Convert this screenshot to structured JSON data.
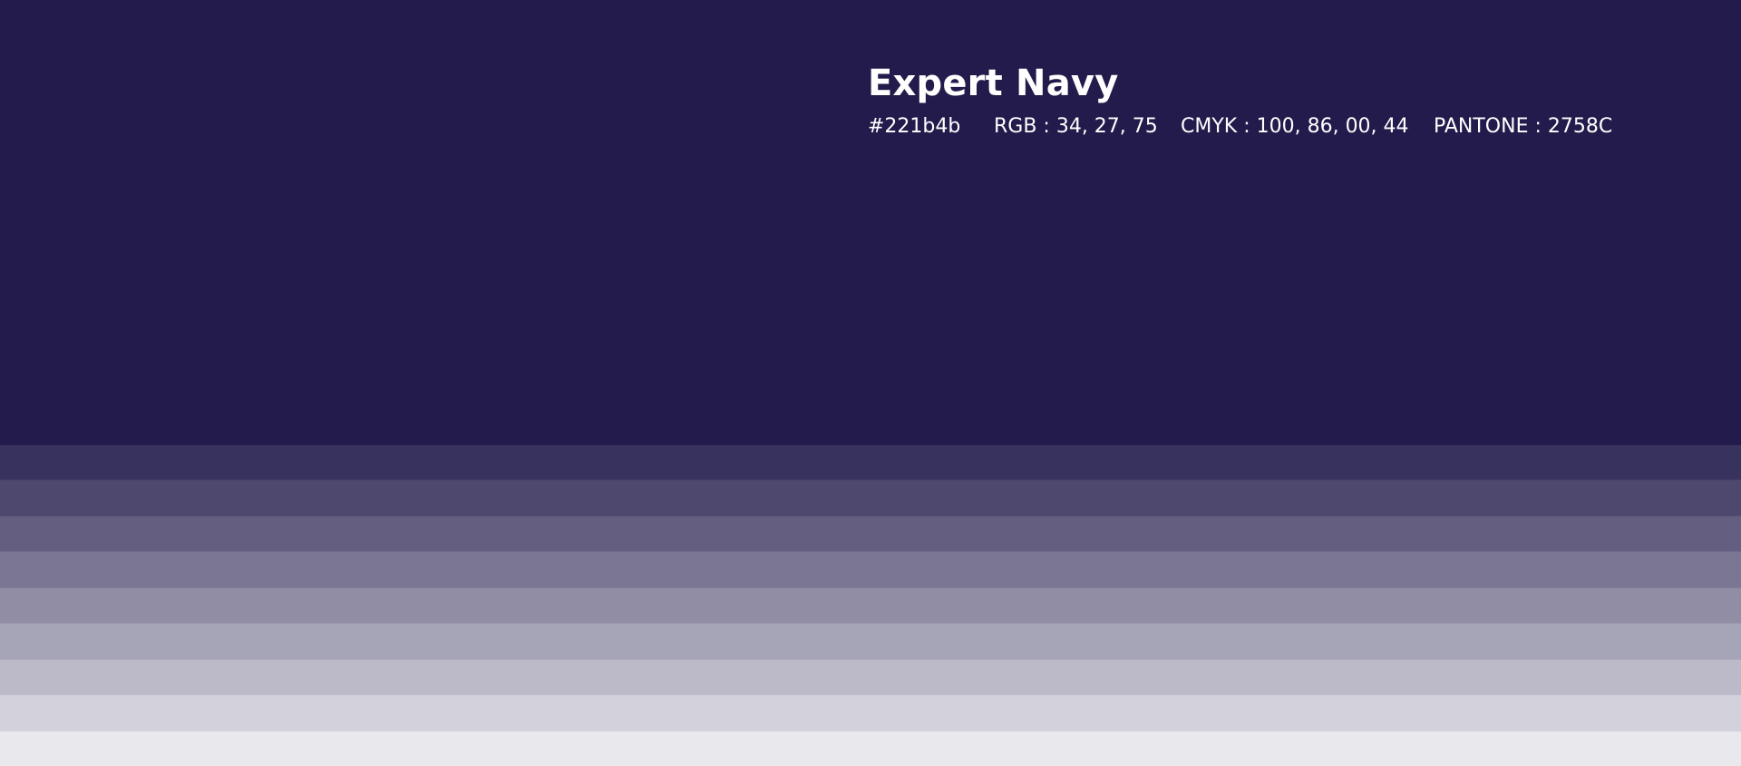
{
  "swatch": {
    "name": "Expert Navy",
    "hex": "#221b4b",
    "rgb": "RGB : 34, 27, 75",
    "cmyk": "CMYK : 100, 86, 00, 44",
    "pantone": "PANTONE : 2758C",
    "base_color": "#221b4b"
  },
  "tints": [
    {
      "color": "#38325e"
    },
    {
      "color": "#4e486f"
    },
    {
      "color": "#645f81"
    },
    {
      "color": "#7a7693"
    },
    {
      "color": "#908da5"
    },
    {
      "color": "#a6a4b7"
    },
    {
      "color": "#bcbac9"
    },
    {
      "color": "#d3d1dc"
    },
    {
      "color": "#e9e8ed"
    }
  ]
}
